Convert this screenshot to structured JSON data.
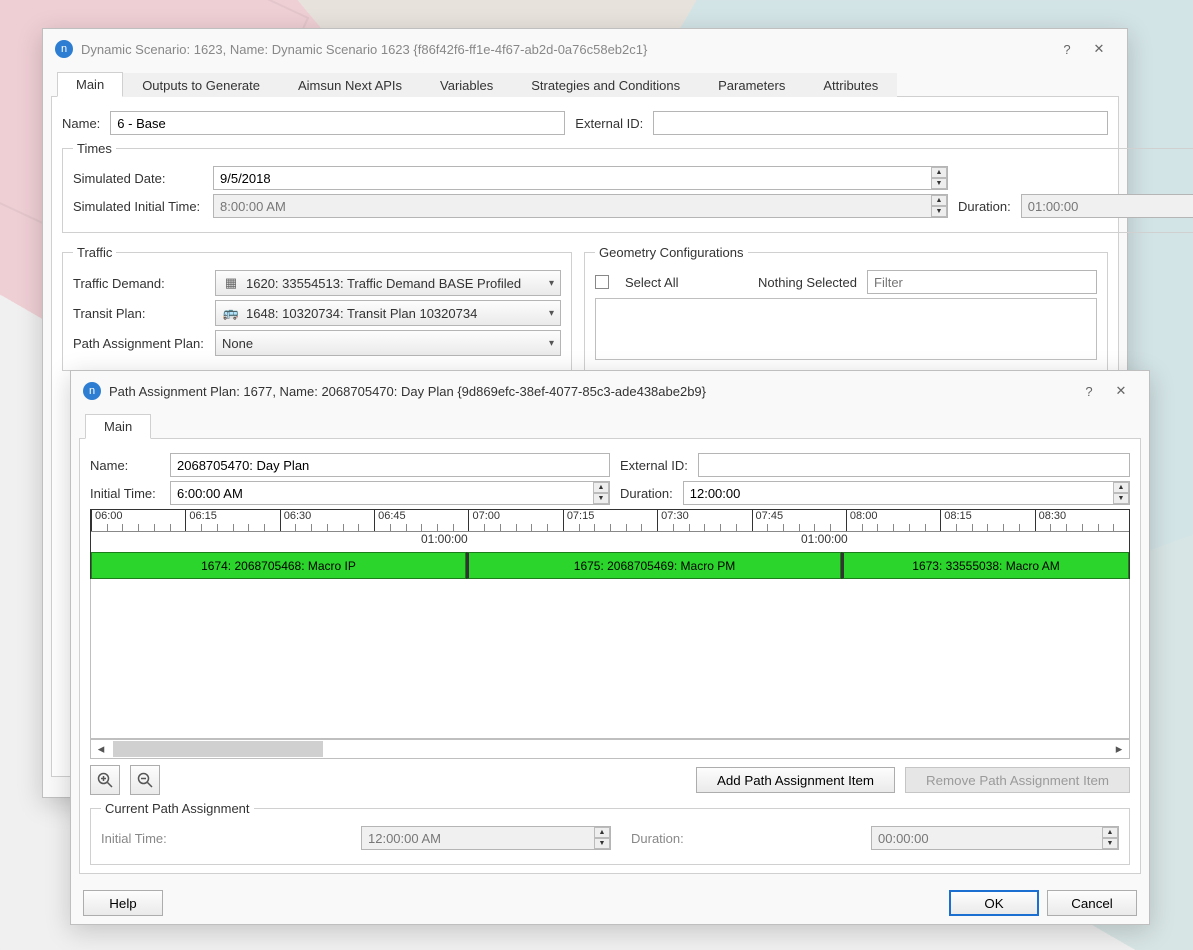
{
  "win1": {
    "title": "Dynamic Scenario: 1623, Name: Dynamic Scenario 1623  {f86f42f6-ff1e-4f67-ab2d-0a76c58eb2c1}",
    "help_glyph": "?",
    "close_glyph": "✕",
    "tabs": [
      "Main",
      "Outputs to Generate",
      "Aimsun Next APIs",
      "Variables",
      "Strategies and Conditions",
      "Parameters",
      "Attributes"
    ],
    "name_label": "Name:",
    "name_value": "6 - Base",
    "external_id_label": "External ID:",
    "external_id_value": "",
    "times": {
      "legend": "Times",
      "sim_date_label": "Simulated Date:",
      "sim_date_value": "9/5/2018",
      "sim_initial_time_label": "Simulated Initial Time:",
      "sim_initial_time_value": "8:00:00 AM",
      "duration_label": "Duration:",
      "duration_value": "01:00:00"
    },
    "traffic": {
      "legend": "Traffic",
      "demand_label": "Traffic Demand:",
      "demand_value": "1620: 33554513: Traffic Demand BASE Profiled",
      "transit_label": "Transit Plan:",
      "transit_value": "1648: 10320734: Transit Plan 10320734",
      "path_label": "Path Assignment Plan:",
      "path_value": "None"
    },
    "geom": {
      "legend": "Geometry Configurations",
      "select_all_label": "Select All",
      "nothing_label": "Nothing Selected",
      "filter_placeholder": "Filter"
    }
  },
  "win2": {
    "title": "Path Assignment Plan: 1677, Name: 2068705470: Day Plan  {9d869efc-38ef-4077-85c3-ade438abe2b9}",
    "help_glyph": "?",
    "close_glyph": "✕",
    "tab_label": "Main",
    "name_label": "Name:",
    "name_value": "2068705470: Day Plan",
    "external_id_label": "External ID:",
    "external_id_value": "",
    "initial_time_label": "Initial Time:",
    "initial_time_value": "6:00:00 AM",
    "duration_label": "Duration:",
    "duration_value": "12:00:00",
    "ruler_ticks": [
      "06:00",
      "06:15",
      "06:30",
      "06:45",
      "07:00",
      "07:15",
      "07:30",
      "07:45",
      "08:00",
      "08:15",
      "08:30"
    ],
    "span_label_1": "01:00:00",
    "span_label_2": "01:00:00",
    "bars": [
      {
        "label": "1674: 2068705468: Macro IP"
      },
      {
        "label": "1675: 2068705469: Macro PM"
      },
      {
        "label": "1673: 33555038: Macro AM"
      }
    ],
    "add_btn": "Add Path Assignment Item",
    "remove_btn": "Remove Path Assignment Item",
    "cpa": {
      "legend": "Current Path Assignment",
      "initial_time_label": "Initial Time:",
      "initial_time_value": "12:00:00 AM",
      "duration_label": "Duration:",
      "duration_value": "00:00:00"
    },
    "help_btn": "Help",
    "ok_btn": "OK",
    "cancel_btn": "Cancel"
  }
}
